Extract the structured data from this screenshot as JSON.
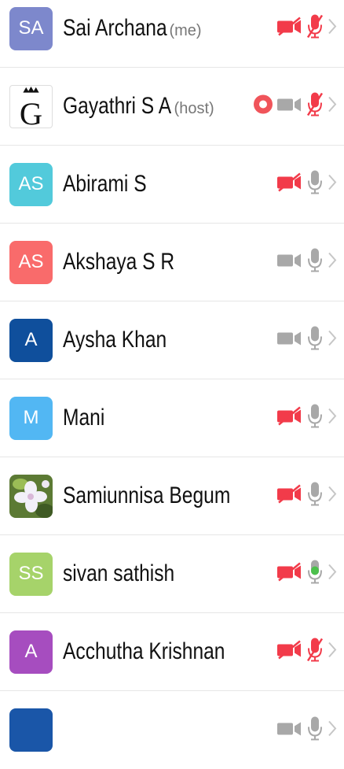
{
  "participants": [
    {
      "initials": "SA",
      "name": "Sai Archana",
      "tag": "(me)",
      "avatar": "initials",
      "color": "#7d88cc",
      "recording": false,
      "video": "off",
      "mic": "off"
    },
    {
      "initials": "G",
      "name": "Gayathri S A",
      "tag": "(host)",
      "avatar": "crest",
      "color": "#ffffff",
      "recording": true,
      "video": "on",
      "mic": "off"
    },
    {
      "initials": "AS",
      "name": "Abirami S",
      "tag": "",
      "avatar": "initials",
      "color": "#52cadb",
      "recording": false,
      "video": "off",
      "mic": "on"
    },
    {
      "initials": "AS",
      "name": "Akshaya S R",
      "tag": "",
      "avatar": "initials",
      "color": "#f96b6b",
      "recording": false,
      "video": "on",
      "mic": "on"
    },
    {
      "initials": "A",
      "name": "Aysha Khan",
      "tag": "",
      "avatar": "initials",
      "color": "#0f4f9c",
      "recording": false,
      "video": "on",
      "mic": "on"
    },
    {
      "initials": "M",
      "name": "Mani",
      "tag": "",
      "avatar": "initials",
      "color": "#52b7f3",
      "recording": false,
      "video": "off",
      "mic": "on"
    },
    {
      "initials": "",
      "name": "Samiunnisa Begum",
      "tag": "",
      "avatar": "photo",
      "color": "#6a8c3a",
      "recording": false,
      "video": "off",
      "mic": "on"
    },
    {
      "initials": "SS",
      "name": "sivan sathish",
      "tag": "",
      "avatar": "initials",
      "color": "#a6d36a",
      "recording": false,
      "video": "off",
      "mic": "speaking"
    },
    {
      "initials": "A",
      "name": "Acchutha Krishnan",
      "tag": "",
      "avatar": "initials",
      "color": "#a64dbf",
      "recording": false,
      "video": "off",
      "mic": "off"
    },
    {
      "initials": "",
      "name": "",
      "tag": "",
      "avatar": "initials",
      "color": "#1a56a8",
      "recording": false,
      "video": "on",
      "mic": "on"
    }
  ],
  "colors": {
    "muted_red": "#f23b4a",
    "icon_gray": "#a8a8a8",
    "speaking_green": "#4cc04c",
    "record_red": "#f0545a",
    "chevron": "#c6c6c6"
  }
}
